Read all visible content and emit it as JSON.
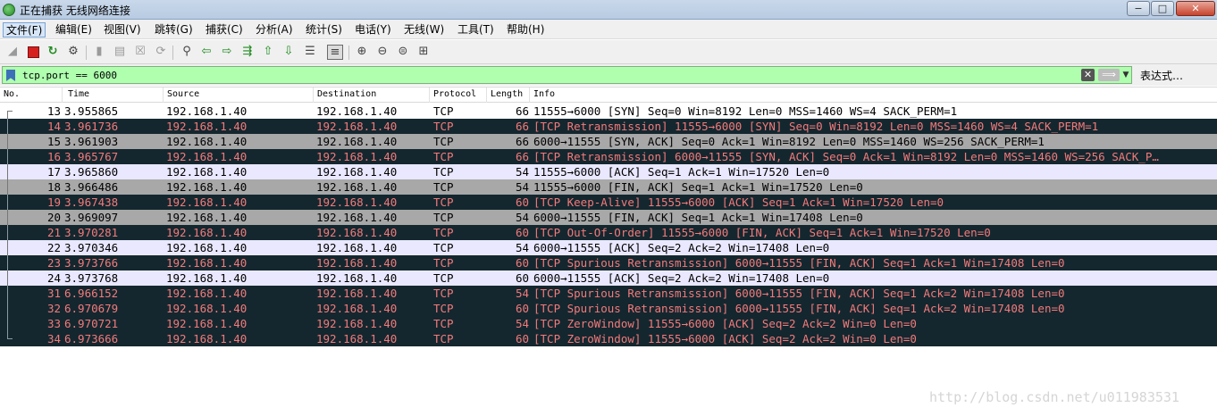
{
  "window": {
    "title": "正在捕获 无线网络连接",
    "minimize_glyph": "−",
    "maximize_glyph": "□",
    "close_glyph": "✕"
  },
  "menu": {
    "items": [
      "文件(F)",
      "编辑(E)",
      "视图(V)",
      "跳转(G)",
      "捕获(C)",
      "分析(A)",
      "统计(S)",
      "电话(Y)",
      "无线(W)",
      "工具(T)",
      "帮助(H)"
    ],
    "active_index": 0
  },
  "filter": {
    "value": "tcp.port == 6000",
    "expression_label": "表达式…",
    "clear_glyph": "✕",
    "apply_glyph": "⟹",
    "dropdown_glyph": "▼",
    "color": "#afffaf"
  },
  "columns": [
    "No.",
    "Time",
    "Source",
    "Destination",
    "Protocol",
    "Length",
    "Info"
  ],
  "row_colors": {
    "selected": "#ffffff",
    "bad_bg": "#14272f",
    "bad_fg": "#f37a7a",
    "gray": "#a8a8a8",
    "light": "#e9e8ff"
  },
  "packets": [
    {
      "no": "13",
      "time": "3.955865",
      "source": "192.168.1.40",
      "destination": "192.168.1.40",
      "protocol": "TCP",
      "length": "66",
      "info": "11555→6000 [SYN] Seq=0 Win=8192 Len=0 MSS=1460 WS=4 SACK_PERM=1",
      "style": "selected"
    },
    {
      "no": "14",
      "time": "3.961736",
      "source": "192.168.1.40",
      "destination": "192.168.1.40",
      "protocol": "TCP",
      "length": "66",
      "info": "[TCP Retransmission] 11555→6000 [SYN] Seq=0 Win=8192 Len=0 MSS=1460 WS=4 SACK_PERM=1",
      "style": "bad"
    },
    {
      "no": "15",
      "time": "3.961903",
      "source": "192.168.1.40",
      "destination": "192.168.1.40",
      "protocol": "TCP",
      "length": "66",
      "info": "6000→11555 [SYN, ACK] Seq=0 Ack=1 Win=8192 Len=0 MSS=1460 WS=256 SACK_PERM=1",
      "style": "gray"
    },
    {
      "no": "16",
      "time": "3.965767",
      "source": "192.168.1.40",
      "destination": "192.168.1.40",
      "protocol": "TCP",
      "length": "66",
      "info": "[TCP Retransmission] 6000→11555 [SYN, ACK] Seq=0 Ack=1 Win=8192 Len=0 MSS=1460 WS=256 SACK_P…",
      "style": "bad"
    },
    {
      "no": "17",
      "time": "3.965860",
      "source": "192.168.1.40",
      "destination": "192.168.1.40",
      "protocol": "TCP",
      "length": "54",
      "info": "11555→6000 [ACK] Seq=1 Ack=1 Win=17520 Len=0",
      "style": "light"
    },
    {
      "no": "18",
      "time": "3.966486",
      "source": "192.168.1.40",
      "destination": "192.168.1.40",
      "protocol": "TCP",
      "length": "54",
      "info": "11555→6000 [FIN, ACK] Seq=1 Ack=1 Win=17520 Len=0",
      "style": "gray"
    },
    {
      "no": "19",
      "time": "3.967438",
      "source": "192.168.1.40",
      "destination": "192.168.1.40",
      "protocol": "TCP",
      "length": "60",
      "info": "[TCP Keep-Alive] 11555→6000 [ACK] Seq=1 Ack=1 Win=17520 Len=0",
      "style": "bad"
    },
    {
      "no": "20",
      "time": "3.969097",
      "source": "192.168.1.40",
      "destination": "192.168.1.40",
      "protocol": "TCP",
      "length": "54",
      "info": "6000→11555 [FIN, ACK] Seq=1 Ack=1 Win=17408 Len=0",
      "style": "gray"
    },
    {
      "no": "21",
      "time": "3.970281",
      "source": "192.168.1.40",
      "destination": "192.168.1.40",
      "protocol": "TCP",
      "length": "60",
      "info": "[TCP Out-Of-Order] 11555→6000 [FIN, ACK] Seq=1 Ack=1 Win=17520 Len=0",
      "style": "bad"
    },
    {
      "no": "22",
      "time": "3.970346",
      "source": "192.168.1.40",
      "destination": "192.168.1.40",
      "protocol": "TCP",
      "length": "54",
      "info": "6000→11555 [ACK] Seq=2 Ack=2 Win=17408 Len=0",
      "style": "light"
    },
    {
      "no": "23",
      "time": "3.973766",
      "source": "192.168.1.40",
      "destination": "192.168.1.40",
      "protocol": "TCP",
      "length": "60",
      "info": "[TCP Spurious Retransmission] 6000→11555 [FIN, ACK] Seq=1 Ack=1 Win=17408 Len=0",
      "style": "bad"
    },
    {
      "no": "24",
      "time": "3.973768",
      "source": "192.168.1.40",
      "destination": "192.168.1.40",
      "protocol": "TCP",
      "length": "60",
      "info": "6000→11555 [ACK] Seq=2 Ack=2 Win=17408 Len=0",
      "style": "light"
    },
    {
      "no": "31",
      "time": "6.966152",
      "source": "192.168.1.40",
      "destination": "192.168.1.40",
      "protocol": "TCP",
      "length": "54",
      "info": "[TCP Spurious Retransmission] 6000→11555 [FIN, ACK] Seq=1 Ack=2 Win=17408 Len=0",
      "style": "bad"
    },
    {
      "no": "32",
      "time": "6.970679",
      "source": "192.168.1.40",
      "destination": "192.168.1.40",
      "protocol": "TCP",
      "length": "60",
      "info": "[TCP Spurious Retransmission] 6000→11555 [FIN, ACK] Seq=1 Ack=2 Win=17408 Len=0",
      "style": "bad"
    },
    {
      "no": "33",
      "time": "6.970721",
      "source": "192.168.1.40",
      "destination": "192.168.1.40",
      "protocol": "TCP",
      "length": "54",
      "info": "[TCP ZeroWindow] 11555→6000 [ACK] Seq=2 Ack=2 Win=0 Len=0",
      "style": "bad"
    },
    {
      "no": "34",
      "time": "6.973666",
      "source": "192.168.1.40",
      "destination": "192.168.1.40",
      "protocol": "TCP",
      "length": "60",
      "info": "[TCP ZeroWindow] 11555→6000 [ACK] Seq=2 Ack=2 Win=0 Len=0",
      "style": "bad"
    }
  ],
  "watermark": "http://blog.csdn.net/u011983531",
  "toolbar_icons": [
    "shark-fin-icon",
    "stop-capture-icon",
    "restart-capture-icon",
    "capture-options-icon",
    "open-file-icon",
    "save-file-icon",
    "close-file-icon",
    "reload-file-icon",
    "find-packet-icon",
    "go-back-icon",
    "go-forward-icon",
    "go-to-packet-icon",
    "first-packet-icon",
    "last-packet-icon",
    "auto-scroll-icon",
    "colorize-icon",
    "zoom-in-icon",
    "zoom-out-icon",
    "zoom-normal-icon",
    "resize-columns-icon"
  ]
}
